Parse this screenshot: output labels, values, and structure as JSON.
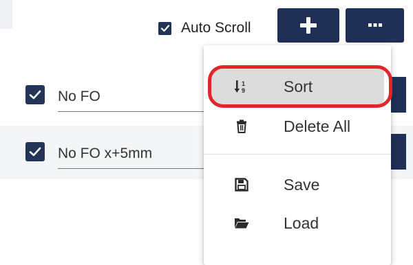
{
  "toolbar": {
    "auto_scroll_label": "Auto Scroll",
    "auto_scroll_checked": true,
    "add_icon": "plus-icon",
    "more_icon": "more-horizontal-icon"
  },
  "rows": [
    {
      "label": "No FO",
      "checked": true
    },
    {
      "label": "No FO x+5mm",
      "checked": true
    }
  ],
  "menu": {
    "items": [
      {
        "label": "Sort",
        "icon": "sort-numeric-icon",
        "highlighted": true
      },
      {
        "label": "Delete All",
        "icon": "trash-icon"
      },
      {
        "label": "Save",
        "icon": "save-icon"
      },
      {
        "label": "Load",
        "icon": "folder-open-icon"
      }
    ]
  },
  "colors": {
    "primary": "#1f2f55",
    "checkbox": "#233456",
    "highlight_ring": "#e0262b",
    "menu_hover": "#dcdcdc"
  }
}
